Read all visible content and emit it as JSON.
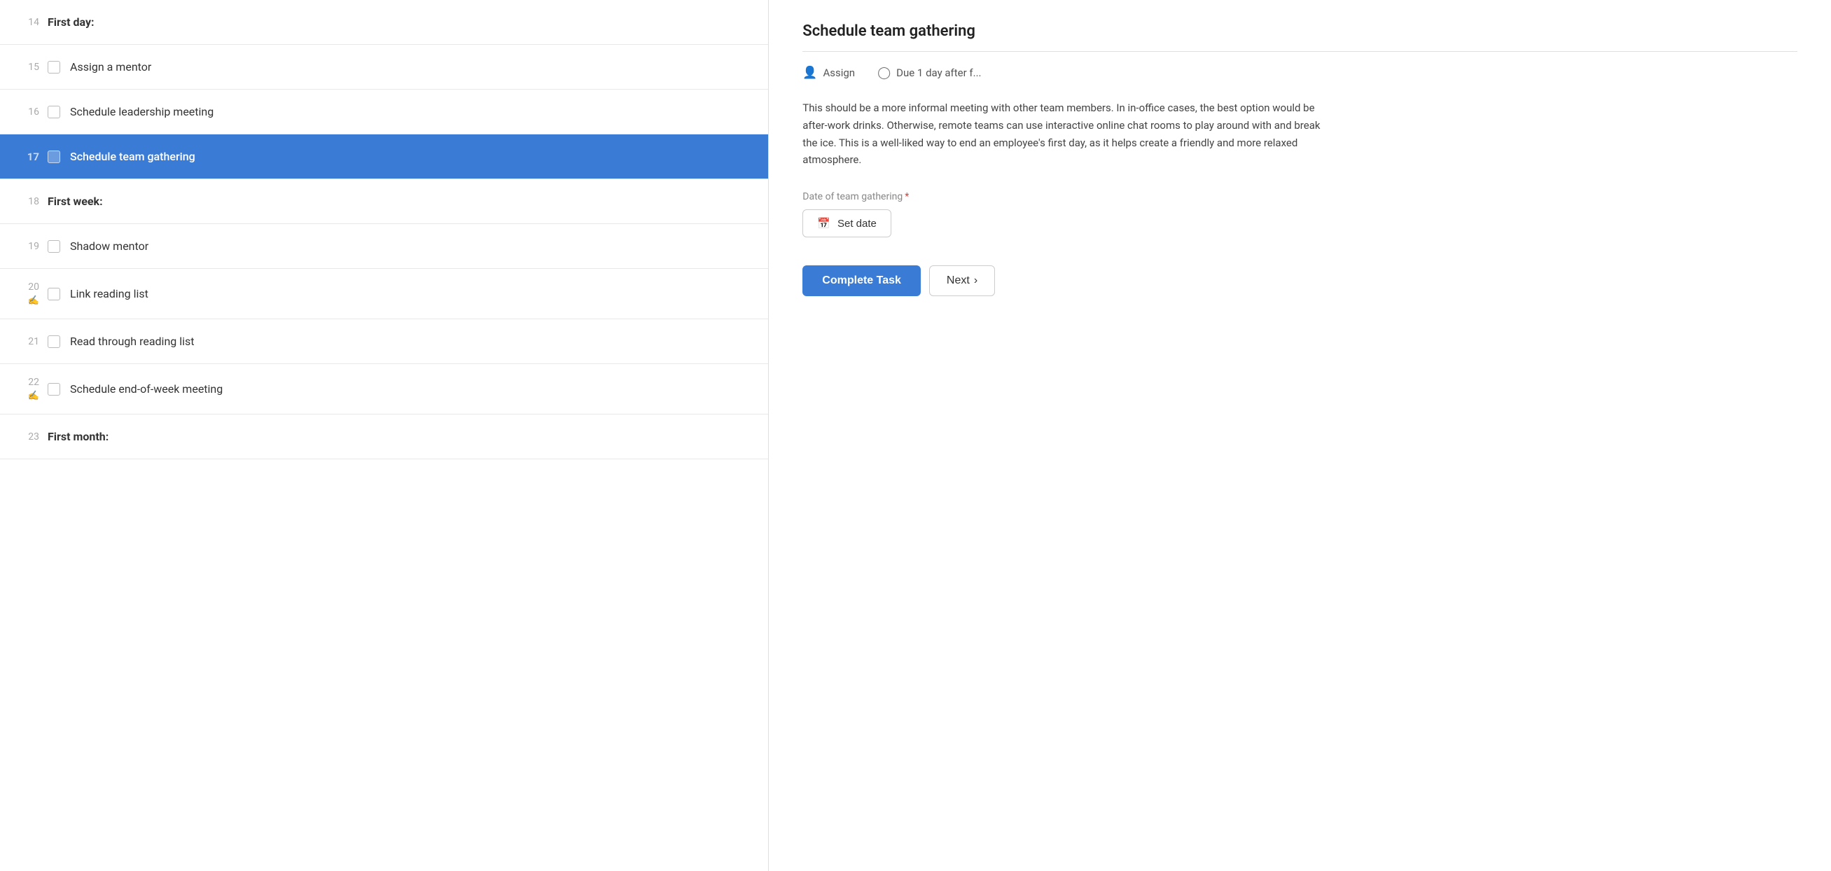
{
  "leftPanel": {
    "items": [
      {
        "id": "14",
        "type": "section",
        "label": "First day:"
      },
      {
        "id": "15",
        "type": "task",
        "label": "Assign a mentor",
        "active": false
      },
      {
        "id": "16",
        "type": "task",
        "label": "Schedule leadership meeting",
        "active": false
      },
      {
        "id": "17",
        "type": "task",
        "label": "Schedule team gathering",
        "active": true
      },
      {
        "id": "18",
        "type": "section",
        "label": "First week:"
      },
      {
        "id": "19",
        "type": "task",
        "label": "Shadow mentor",
        "active": false
      },
      {
        "id": "20",
        "type": "task",
        "label": "Link reading list",
        "active": false,
        "hasHand": true
      },
      {
        "id": "21",
        "type": "task",
        "label": "Read through reading list",
        "active": false
      },
      {
        "id": "22",
        "type": "task",
        "label": "Schedule end-of-week meeting",
        "active": false,
        "hasHand": true
      },
      {
        "id": "23",
        "type": "section",
        "label": "First month:"
      }
    ]
  },
  "rightPanel": {
    "title": "Schedule team gathering",
    "meta": {
      "assign": "Assign",
      "due": "Due 1 day after f..."
    },
    "description": "This should be a more informal meeting with other team members. In in-office cases, the best option would be after-work drinks. Otherwise, remote teams can use interactive online chat rooms to play around with and break the ice. This is a well-liked way to end an employee's first day, as it helps create a friendly and more relaxed atmosphere.",
    "fieldLabel": "Date of team gathering",
    "setDateLabel": "Set date",
    "completeTaskLabel": "Complete Task",
    "nextLabel": "Next",
    "icons": {
      "assign": "👤",
      "clock": "⏰",
      "calendar": "📅",
      "chevron": "›"
    }
  }
}
